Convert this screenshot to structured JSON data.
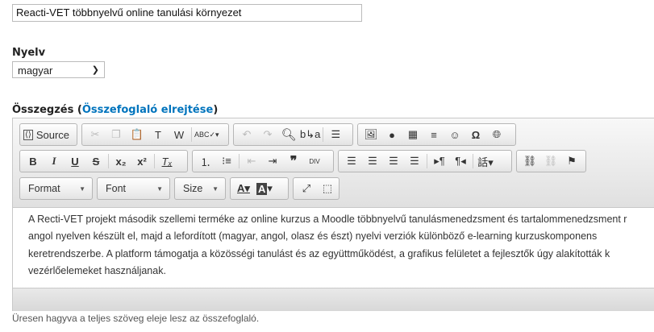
{
  "title_input": {
    "value": "Reacti-VET többnyelvű online tanulási környezet"
  },
  "language": {
    "label": "Nyelv",
    "selected": "magyar"
  },
  "summary": {
    "label": "Összegzés",
    "toggle_link": "Összefoglaló elrejtése",
    "hint": "Üresen hagyva a teljes szöveg eleje lesz az összefoglaló."
  },
  "toolbar": {
    "source": "Source",
    "format": "Format",
    "font": "Font",
    "size": "Size"
  },
  "content": {
    "lines": [
      "A Recti-VET projekt második szellemi terméke az online kurzus a Moodle többnyelvű tanulásmenedzsment és tartalommenedzsment r",
      "angol nyelven készült el, majd a lefordított (magyar, angol, olasz és észt) nyelvi verziók különböző e-learning kurzuskomponens",
      "keretrendszerbe. A platform támogatja a közösségi tanulást és az együttműködést, a grafikus felületet a fejlesztők úgy alakították k",
      "vezérlőelemeket használjanak."
    ]
  }
}
